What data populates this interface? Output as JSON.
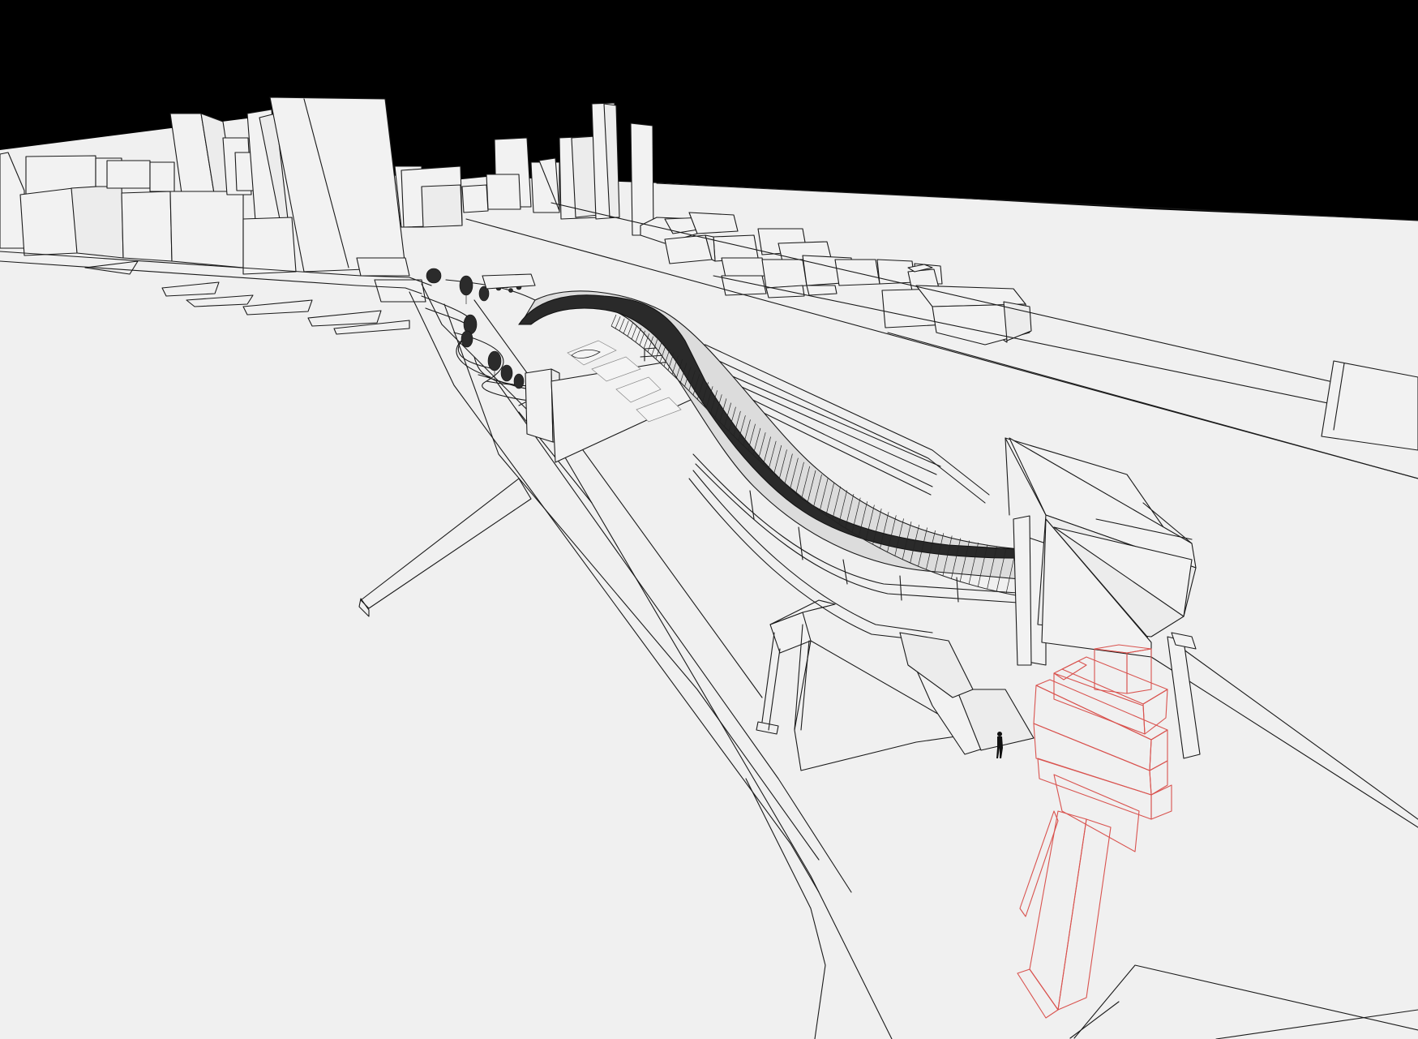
{
  "scene": {
    "view": "3d-wireframe-viewport",
    "subject": "bridge",
    "background_color": "#f0f0f0",
    "sky_color": "#000000",
    "line_color": "#1a1a1a",
    "highlight_color": "#d9534f"
  }
}
